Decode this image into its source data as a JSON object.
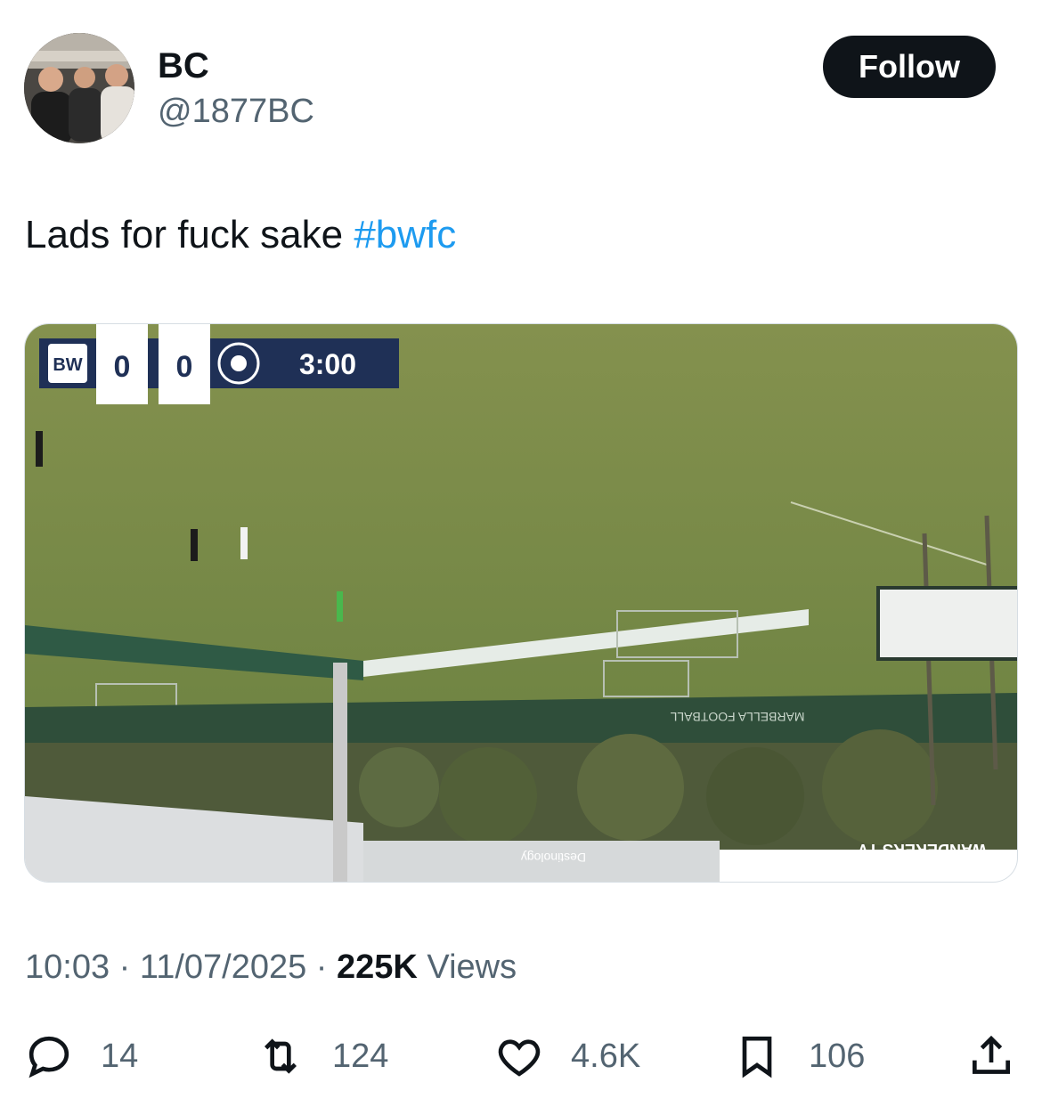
{
  "author": {
    "display_name": "BC",
    "handle": "@1877BC",
    "follow_label": "Follow"
  },
  "tweet": {
    "text": "Lads for fuck sake",
    "hashtag": "#bwfc"
  },
  "media": {
    "scoreboard": {
      "home_score": "0",
      "away_score": "0",
      "clock": "3:00"
    },
    "watermark": "WANDERERS TV",
    "sponsor_mark": "Destinology",
    "ad_board_text": "MARBELLA FOOTBALL"
  },
  "meta": {
    "time": "10:03",
    "separator1": " · ",
    "date": "11/07/2025",
    "separator2": " · ",
    "views_count": "225K",
    "views_label": " Views"
  },
  "actions": {
    "replies": "14",
    "reposts": "124",
    "likes": "4.6K",
    "bookmarks": "106"
  },
  "colors": {
    "accent": "#1d9bf0",
    "text": "#0f1419",
    "secondary": "#536471",
    "scoreboard_navy": "#1f3056",
    "pitch": "#7f8f4c"
  }
}
